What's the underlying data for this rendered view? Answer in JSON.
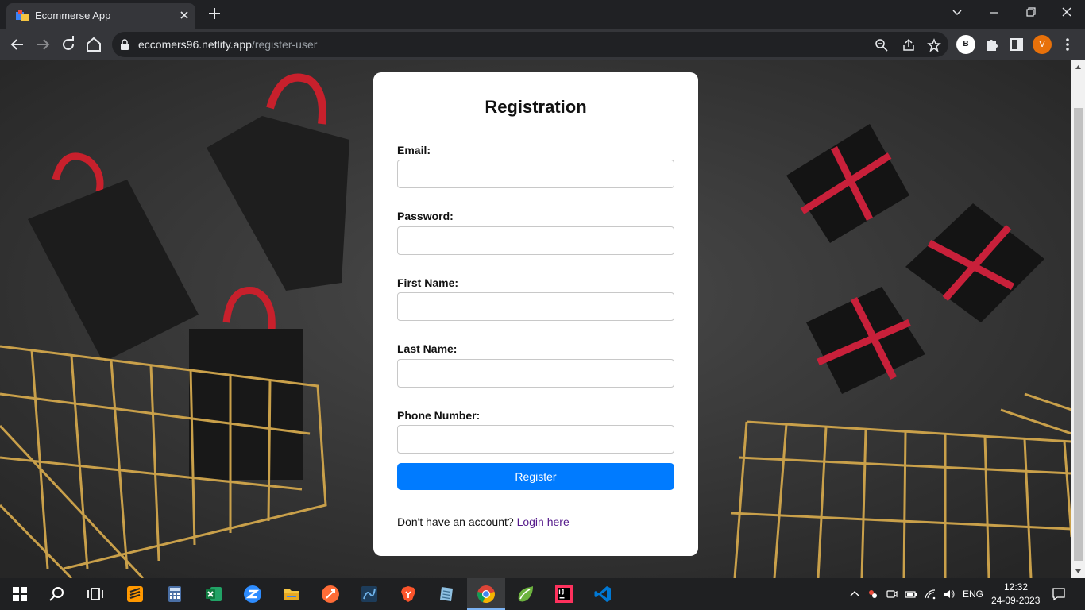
{
  "browser": {
    "tab_title": "Ecommerse App",
    "url_domain": "eccomers96.netlify.app",
    "url_path": "/register-user",
    "profile_b_initial": "B",
    "profile_v_initial": "V"
  },
  "form": {
    "title": "Registration",
    "fields": [
      {
        "label": "Email:",
        "value": "",
        "type": "email"
      },
      {
        "label": "Password:",
        "value": "",
        "type": "password"
      },
      {
        "label": "First Name:",
        "value": "",
        "type": "text"
      },
      {
        "label": "Last Name:",
        "value": "",
        "type": "text"
      },
      {
        "label": "Phone Number:",
        "value": "",
        "type": "tel"
      }
    ],
    "submit_label": "Register",
    "login_prompt": "Don't have an account?",
    "login_link": "Login here"
  },
  "taskbar": {
    "apps": [
      "start-icon",
      "search-icon",
      "task-view-icon",
      "sublime-text-icon",
      "calculator-icon",
      "excel-icon",
      "zoom-icon",
      "file-explorer-icon",
      "postman-icon",
      "mysql-workbench-icon",
      "brave-icon",
      "notepad-icon",
      "chrome-icon",
      "spring-tools-icon",
      "intellij-icon",
      "vscode-icon"
    ],
    "language": "ENG",
    "time": "12:32",
    "date": "24-09-2023"
  },
  "colors": {
    "accent": "#007bff",
    "link": "#551a8b",
    "browser_chrome": "#35363a"
  }
}
